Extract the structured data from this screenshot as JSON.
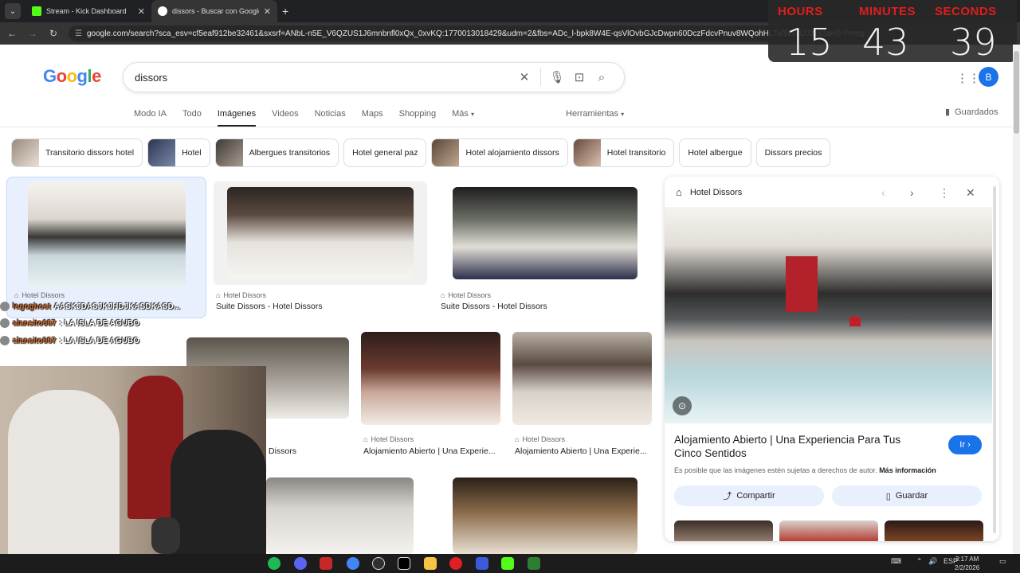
{
  "browser": {
    "tabs": [
      {
        "title": "Stream - Kick Dashboard",
        "favicon_color": "#53fc18",
        "active": false
      },
      {
        "title": "dissors - Buscar con Google",
        "favicon_color": "#ffffff",
        "active": true
      }
    ],
    "new_tab_label": "+",
    "url": "google.com/search?sca_esv=cf5eaf912be32461&sxsrf=ANbL-n5E_V6QZUS1J6mnbnfl0xQx_0xvKQ:1770013018429&udm=2&fbs=ADc_l-bpk8W4E-qsVlOvbGJcDwpn60DczFdcvPnuv8WQohHLTaf9fS4tJ71bi2aHS-Pmegz...NEuqZZKqmjKD..."
  },
  "timer": {
    "hours_label": "HOURS",
    "minutes_label": "MINUTES",
    "seconds_label": "SECONDS",
    "hours": "15",
    "minutes": "43",
    "seconds": "39"
  },
  "google": {
    "logo": "Google",
    "query": "dissors",
    "avatar_letter": "B",
    "tabs": [
      "Modo IA",
      "Todo",
      "Imágenes",
      "Videos",
      "Noticias",
      "Maps",
      "Shopping",
      "Más"
    ],
    "active_tab": "Imágenes",
    "tools_label": "Herramientas",
    "saved_label": "Guardados",
    "chips": [
      {
        "label": "Transitorio dissors hotel",
        "has_thumb": true
      },
      {
        "label": "Hotel",
        "has_thumb": true
      },
      {
        "label": "Albergues transitorios",
        "has_thumb": true
      },
      {
        "label": "Hotel general paz",
        "has_thumb": false
      },
      {
        "label": "Hotel alojamiento dissors",
        "has_thumb": true
      },
      {
        "label": "Hotel transitorio",
        "has_thumb": true
      },
      {
        "label": "Hotel albergue",
        "has_thumb": false
      },
      {
        "label": "Dissors precios",
        "has_thumb": false
      }
    ],
    "results": [
      {
        "source": "Hotel Dissors",
        "title": ""
      },
      {
        "source": "Hotel Dissors",
        "title": "Suite Dissors - Hotel Dissors"
      },
      {
        "source": "Hotel Dissors",
        "title": "Suite Dissors - Hotel Dissors"
      },
      {
        "source": "",
        "title": "Dissors"
      },
      {
        "source": "Hotel Dissors",
        "title": "Alojamiento Abierto | Una Experie..."
      },
      {
        "source": "Hotel Dissors",
        "title": "Alojamiento Abierto | Una Experie..."
      }
    ]
  },
  "panel": {
    "site": "Hotel Dissors",
    "title": "Alojamiento Abierto | Una Experiencia Para Tus Cinco Sentidos",
    "go_label": "Ir",
    "copyright": "Es posible que las imágenes estén sujetas a derechos de autor.",
    "more_info": "Más información",
    "share_label": "Compartir",
    "save_label": "Guardar"
  },
  "chat": [
    {
      "user": "legoghost",
      "text": "AASKJDASJKJHDJKASDKASD..."
    },
    {
      "user": "alansito687",
      "text": ": LA ISLA DE AGUBO"
    },
    {
      "user": "alansito687",
      "text": ": LA ISLA DE AGUBO"
    }
  ],
  "taskbar": {
    "lang": "ESP",
    "time": "3:17 AM",
    "date": "2/2/2026"
  },
  "colors": {
    "accent": "#1a73e8",
    "timer_label": "#e21d1d",
    "chip_border": "#dadce0"
  }
}
